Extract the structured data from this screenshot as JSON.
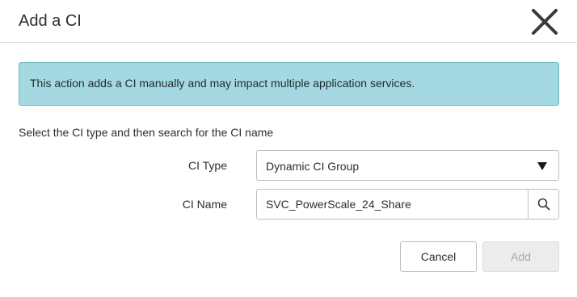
{
  "dialog": {
    "title": "Add a CI",
    "close_icon": "close-icon"
  },
  "alert": {
    "message": "This action adds a CI manually and may impact multiple application services.",
    "background_color": "#a4d9e1",
    "border_color": "#6cb7c4"
  },
  "form": {
    "instruction": "Select the CI type and then search for the CI name",
    "ci_type": {
      "label": "CI Type",
      "selected_value": "Dynamic CI Group",
      "icon": "triangle-down-icon"
    },
    "ci_name": {
      "label": "CI Name",
      "value": "SVC_PowerScale_24_Share",
      "search_icon": "search-icon"
    }
  },
  "buttons": {
    "cancel_label": "Cancel",
    "add_label": "Add",
    "add_enabled": false
  }
}
